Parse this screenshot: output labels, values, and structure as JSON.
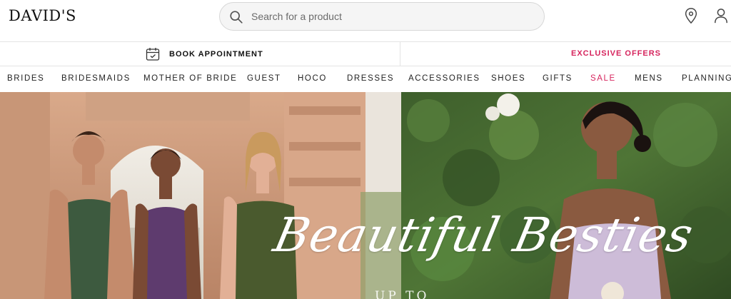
{
  "brand": {
    "logo_text": "DAVID'S"
  },
  "search": {
    "placeholder": "Search for a product"
  },
  "header_icons": [
    "search-icon",
    "location-pin-icon",
    "account-icon"
  ],
  "utility_bar": {
    "book_appointment": "BOOK APPOINTMENT",
    "exclusive_offers": "EXCLUSIVE OFFERS"
  },
  "nav": {
    "items": [
      {
        "label": "BRIDES"
      },
      {
        "label": "BRIDESMAIDS"
      },
      {
        "label": "MOTHER OF BRIDE"
      },
      {
        "label": "GUEST"
      },
      {
        "label": "HOCO"
      },
      {
        "label": "DRESSES"
      },
      {
        "label": "ACCESSORIES"
      },
      {
        "label": "SHOES"
      },
      {
        "label": "GIFTS"
      },
      {
        "label": "SALE"
      },
      {
        "label": "MENS"
      },
      {
        "label": "PLANNING"
      }
    ]
  },
  "hero": {
    "headline": "Beautiful Besties",
    "subtext": "UP TO"
  },
  "colors": {
    "accent_pink": "#d6245d",
    "text_dark": "#111111",
    "search_bg": "#f5f5f5"
  }
}
